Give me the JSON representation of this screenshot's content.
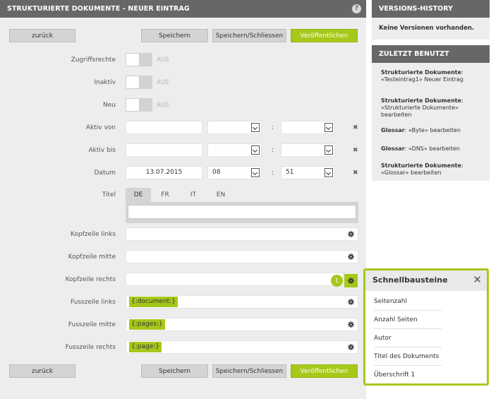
{
  "header": {
    "title": "STRUKTURIERTE DOKUMENTE - NEUER EINTRAG",
    "help": "?"
  },
  "buttons": {
    "back": "zurück",
    "save": "Speichern",
    "save_close": "Speichern/Schliessen",
    "publish": "Veröffentlichen"
  },
  "form": {
    "access_label": "Zugriffsrechte",
    "inactive_label": "Inaktiv",
    "new_label": "Neu",
    "toggle_off": "AUS",
    "active_from_label": "Aktiv von",
    "active_to_label": "Aktiv bis",
    "date_label": "Datum",
    "date_value": "13.07.2015",
    "hour_value": "08",
    "minute_value": "51",
    "colon": ":",
    "clear": "✖",
    "title_label": "Titel",
    "tabs": [
      "DE",
      "FR",
      "IT",
      "EN"
    ],
    "header_left_label": "Kopfzeile links",
    "header_middle_label": "Kopfzeile mitte",
    "header_right_label": "Kopfzeile rechts",
    "footer_left_label": "Fusszeile links",
    "footer_left_value": "{:document:}",
    "footer_middle_label": "Fusszeile mitte",
    "footer_middle_value": "{:pages:}",
    "footer_right_label": "Fusszeile rechts",
    "footer_right_value": "{:page:}",
    "badge": "1"
  },
  "sidebar": {
    "history_title": "VERSIONS-HISTORY",
    "history_empty": "Keine Versionen vorhanden.",
    "recent_title": "ZULETZT BENUTZT",
    "recent": [
      {
        "bold": "Strukturierte Dokumente",
        "rest": ": «Testeintrag1» Neuer Eintrag"
      },
      {
        "bold": "Strukturierte Dokumente",
        "rest": ": «Strukturierte Dokumente» bearbeiten"
      },
      {
        "bold": "Glossar",
        "rest": ": «Byte» bearbeiten"
      },
      {
        "bold": "Glossar",
        "rest": ": «DNS» bearbeiten"
      },
      {
        "bold": "Strukturierte Dokumente",
        "rest": ": «Glossar» bearbeiten"
      }
    ]
  },
  "popup": {
    "title": "Schnellbausteine",
    "close": "✕",
    "items": [
      "Seitenzahl",
      "Anzahl Seiten",
      "Autor",
      "Titel des Dokuments",
      "Überschrift 1"
    ]
  },
  "colors": {
    "accent": "#a6c81b",
    "header_bg": "#676767",
    "panel_bg": "#ededed"
  }
}
